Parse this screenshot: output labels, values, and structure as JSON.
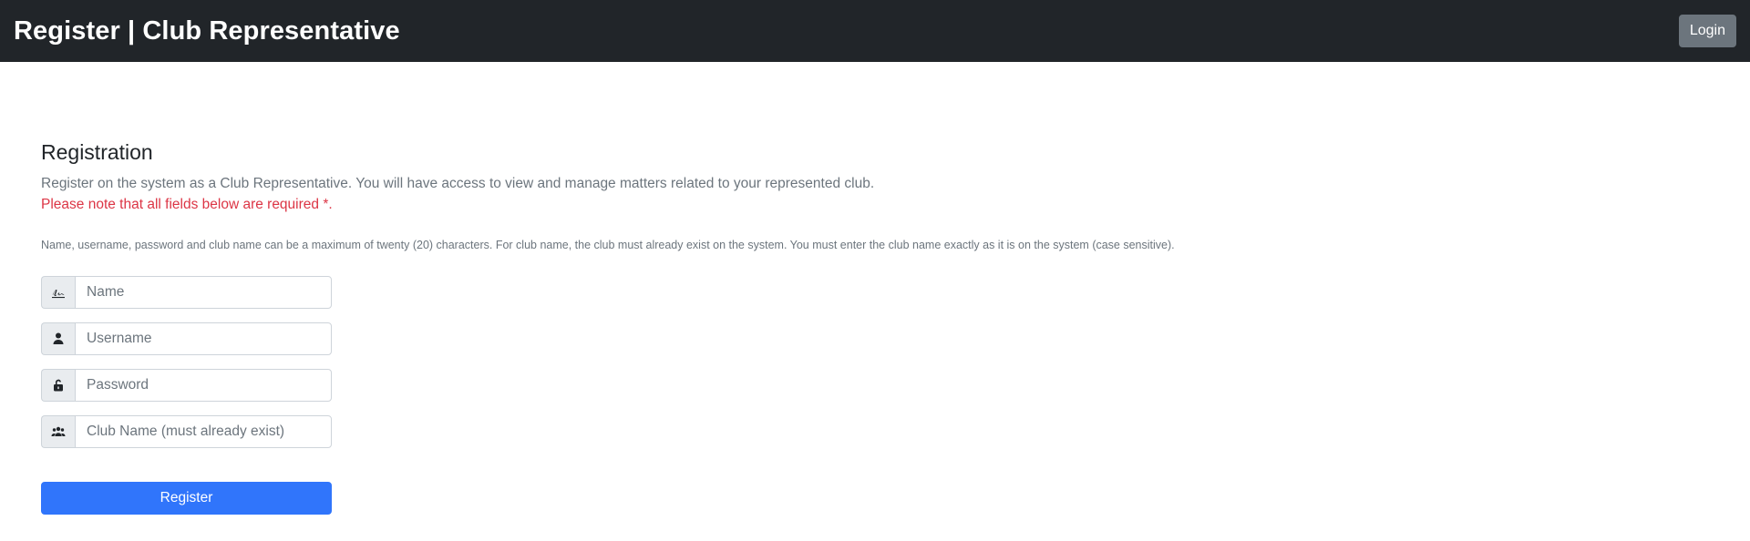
{
  "header": {
    "title": "Register | Club Representative",
    "login_label": "Login"
  },
  "main": {
    "heading": "Registration",
    "intro": "Register on the system as a Club Representative. You will have access to view and manage matters related to your represented club.",
    "required_note": "Please note that all fields below are required *.",
    "rules_note": "Name, username, password and club name can be a maximum of twenty (20) characters. For club name, the club must already exist on the system. You must enter the club name exactly as it is on the system (case sensitive)."
  },
  "form": {
    "name": {
      "placeholder": "Name",
      "value": "",
      "icon": "signature-icon"
    },
    "username": {
      "placeholder": "Username",
      "value": "",
      "icon": "person-icon"
    },
    "password": {
      "placeholder": "Password",
      "value": "",
      "icon": "unlock-icon"
    },
    "club": {
      "placeholder": "Club Name (must already exist)",
      "value": "",
      "icon": "people-icon"
    },
    "submit_label": "Register"
  },
  "colors": {
    "navbar": "#212529",
    "primary": "#3075fb",
    "secondary": "#6c757d",
    "danger": "#dc3545"
  }
}
